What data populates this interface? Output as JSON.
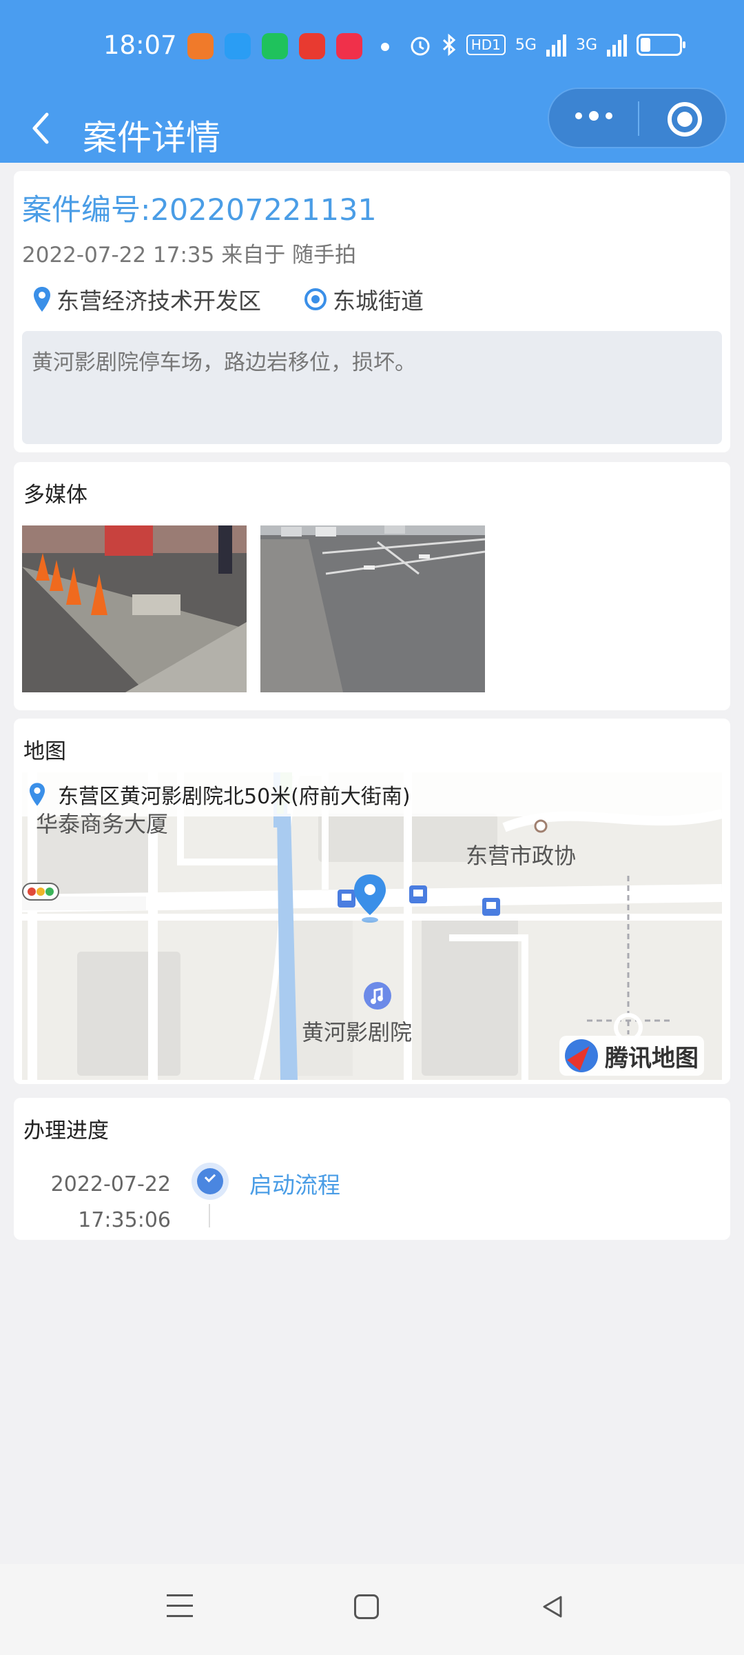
{
  "status_bar": {
    "time": "18:07",
    "hd": "HD1",
    "net1": "5G",
    "net2": "3G",
    "icons": [
      "uc-browser-icon",
      "qq-browser-icon",
      "wechat-icon",
      "app-mascot-icon",
      "video-app-icon",
      "alarm-icon",
      "bluetooth-icon",
      "battery-icon"
    ]
  },
  "nav": {
    "title": "案件详情"
  },
  "case": {
    "number": "案件编号:202207221131",
    "meta": "2022-07-22 17:35 来自于 随手拍",
    "district": "东营经济技术开发区",
    "street": "东城街道",
    "description": "黄河影剧院停车场，路边岩移位，损坏。"
  },
  "media": {
    "title": "多媒体"
  },
  "map": {
    "title": "地图",
    "address": "东营区黄河影剧院北50米(府前大街南)",
    "labels": {
      "building": "华泰商务大厦",
      "gov": "东营市政协",
      "theater": "黄河影剧院"
    },
    "provider": "腾讯地图"
  },
  "progress": {
    "title": "办理进度",
    "items": [
      {
        "date": "2022-07-22",
        "time": "17:35:06",
        "name": "启动流程"
      }
    ]
  },
  "colors": {
    "primary": "#4a9df0",
    "link": "#4a9de6",
    "background": "#f1f1f3"
  }
}
